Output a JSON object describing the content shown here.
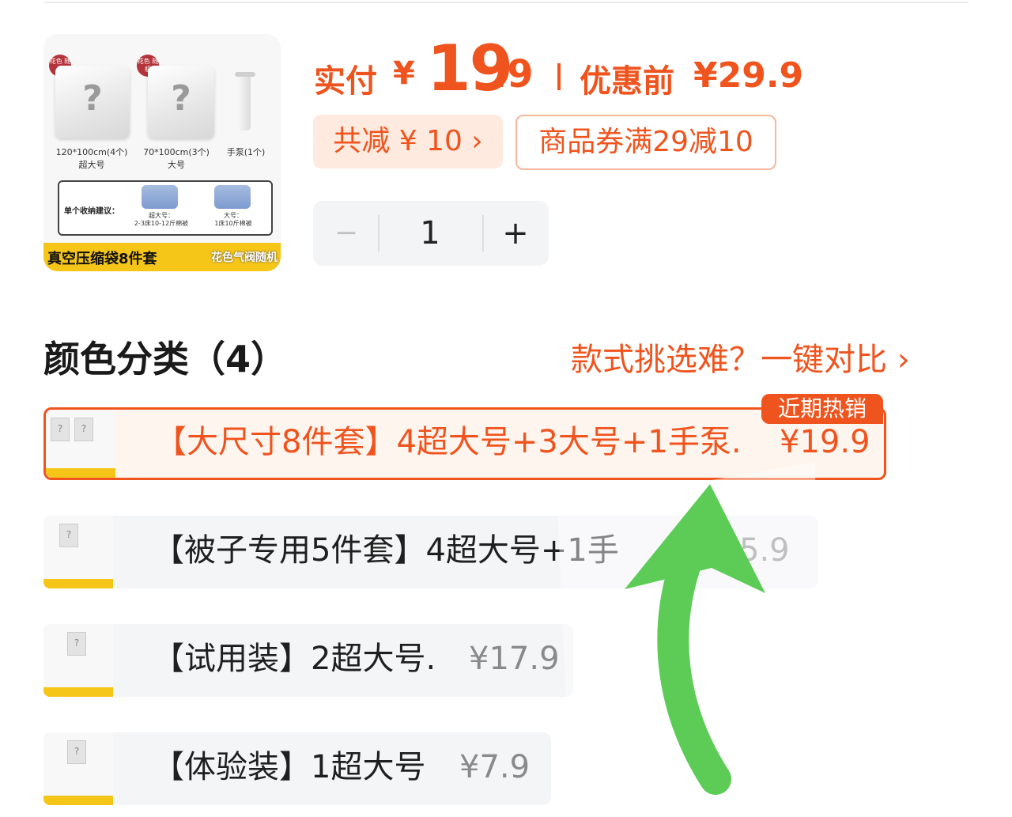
{
  "product_image": {
    "badges": [
      "花色\n随机",
      "花色\n随机"
    ],
    "captions": [
      "120*100cm(4个)\n超大号",
      "70*100cm(3个)\n大号",
      "手泵(1个)"
    ],
    "tip_label": "单个收纳建议：",
    "tip_sub1": "超大号：\n2-3床10-12斤棉被",
    "tip_sub2": "大号：\n1床10斤棉被",
    "banner_main": "真空压缩袋8件套",
    "banner_sub": "花色气阀随机"
  },
  "price": {
    "pay_label": "实付",
    "currency": "¥",
    "pay_integer": "19",
    "pay_decimal": ".9",
    "original_label": "优惠前",
    "original_price": "¥29.9"
  },
  "discount": {
    "total": "共减 ¥ 10 ›",
    "coupon": "商品券满29减10"
  },
  "quantity": {
    "minus": "−",
    "value": "1",
    "plus": "+"
  },
  "color_section": {
    "title": "颜色分类（4）",
    "compare_link": "款式挑选难？一键对比 ›",
    "hot_tag": "近期热销"
  },
  "options": [
    {
      "label": "【大尺寸8件套】4超大号+3大号+1手泵.",
      "price": "¥19.9",
      "selected": true
    },
    {
      "label": "【被子专用5件套】4超大号+1手",
      "price": "5.9",
      "selected": false
    },
    {
      "label": "【试用装】2超大号.",
      "price": "¥17.9",
      "selected": false
    },
    {
      "label": "【体验装】1超大号",
      "price": "¥7.9",
      "selected": false
    }
  ],
  "colors": {
    "accent": "#f0541e",
    "arrow": "#5ccc57",
    "banner": "#f5c518"
  }
}
